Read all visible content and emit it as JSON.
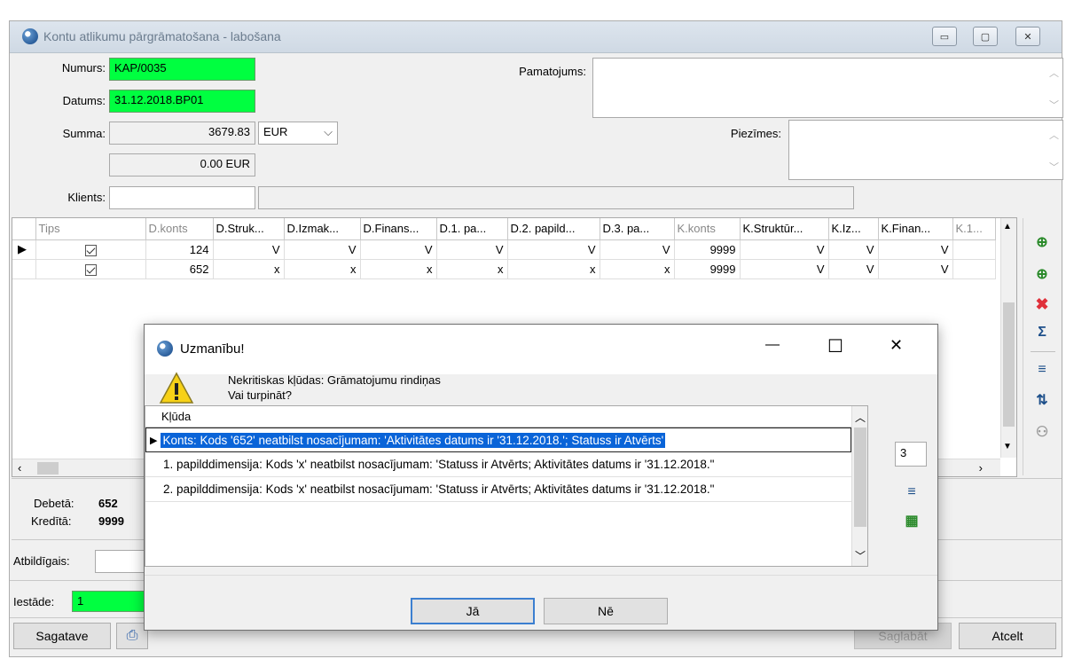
{
  "window": {
    "title": "Kontu atlikumu pārgrāmatošana - labošana",
    "controls": {
      "minimize": "▭",
      "maximize": "▢",
      "close": "✕"
    }
  },
  "form": {
    "numurs_label": "Numurs:",
    "numurs_value": "KAP/0035",
    "datums_label": "Datums:",
    "datums_value": "31.12.2018.BP01",
    "summa_label": "Summa:",
    "summa_value": "3679.83",
    "currency_value": "EUR",
    "summa_diff": "0.00 EUR",
    "klients_label": "Klients:",
    "klients_value": "",
    "klients_name": "",
    "pamatojums_label": "Pamatojums:",
    "piezimes_label": "Piezīmes:"
  },
  "grid": {
    "columns": [
      "Tips",
      "D.konts",
      "D.Struk...",
      "D.Izmak...",
      "D.Finans...",
      "D.1. pa...",
      "D.2. papild...",
      "D.3. pa...",
      "K.konts",
      "K.Struktūr...",
      "K.Iz...",
      "K.Finan...",
      "K.1..."
    ],
    "rows": [
      [
        "124",
        "V",
        "V",
        "V",
        "V",
        "V",
        "V",
        "9999",
        "V",
        "V",
        "V"
      ],
      [
        "652",
        "x",
        "x",
        "x",
        "x",
        "x",
        "x",
        "9999",
        "V",
        "V",
        "V"
      ]
    ]
  },
  "summary": {
    "debets_label": "Debetā:",
    "debets_value": "652",
    "kredits_label": "Kredītā:",
    "kredits_value": "9999"
  },
  "bottom": {
    "atbildigais_label": "Atbildīgais:",
    "iestade_label": "Iestāde:",
    "iestade_value": "1",
    "sagatave_label": "Sagatave",
    "saglabat_label": "Saglabāt",
    "atcelt_label": "Atcelt"
  },
  "dialog": {
    "title": "Uzmanību!",
    "message_line1": "Nekritiskas kļūdas: Grāmatojumu rindiņas",
    "message_line2": "Vai turpināt?",
    "errors_header": "Kļūda",
    "errors": [
      "Konts: Kods '652' neatbilst nosacījumam: 'Aktivitātes datums ir '31.12.2018.'; Statuss ir Atvērts'",
      "1. papilddimensija: Kods 'x' neatbilst nosacījumam: 'Statuss ir Atvērts; Aktivitātes datums ir '31.12.2018.\"",
      "2. papilddimensija: Kods 'x' neatbilst nosacījumam: 'Statuss ir Atvērts; Aktivitātes datums ir '31.12.2018.\""
    ],
    "error_count": "3",
    "yes_label": "Jā",
    "no_label": "Nē",
    "controls": {
      "minimize": "—",
      "maximize": "☐",
      "close": "✕"
    }
  },
  "colors": {
    "required_field": "#00ff40",
    "selection": "#0a64d8"
  }
}
